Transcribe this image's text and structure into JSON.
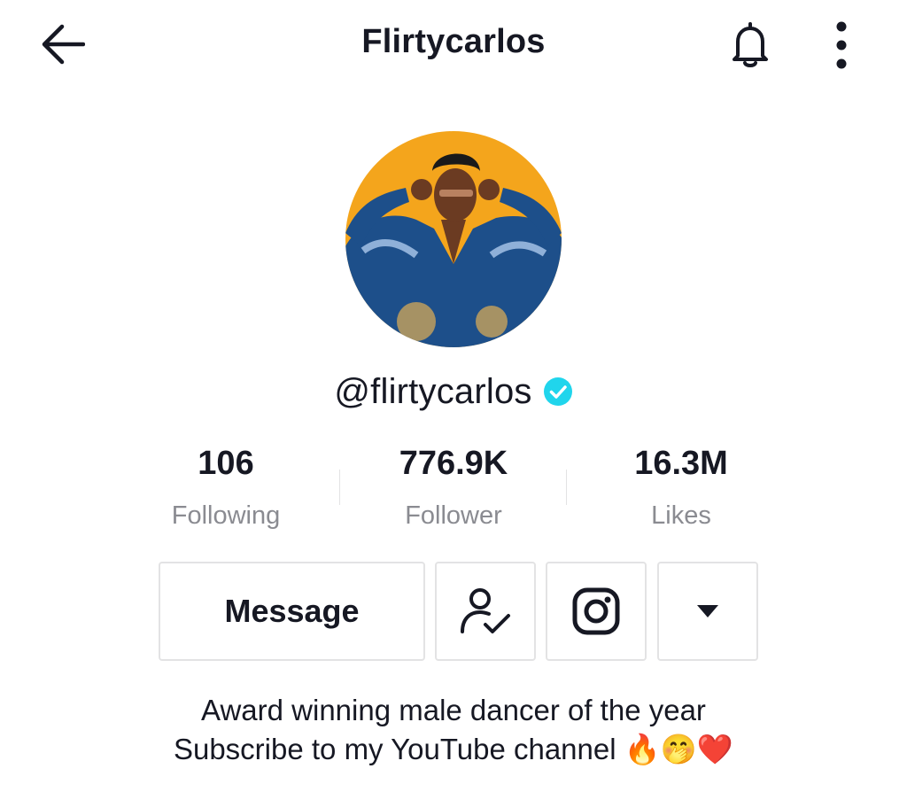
{
  "header": {
    "title": "Flirtycarlos",
    "back_icon": "arrow-left-icon",
    "bell_icon": "bell-icon",
    "more_icon": "vertical-dots-icon"
  },
  "profile": {
    "username": "@flirtycarlos",
    "verified_icon": "verified-check-icon",
    "avatar_icon": "profile-photo"
  },
  "stats": [
    {
      "value": "106",
      "label": "Following"
    },
    {
      "value": "776.9K",
      "label": "Follower"
    },
    {
      "value": "16.3M",
      "label": "Likes"
    }
  ],
  "actions": {
    "message_label": "Message",
    "friend_icon": "user-check-icon",
    "instagram_icon": "instagram-icon",
    "more_icon": "caret-down-icon"
  },
  "bio": {
    "line1": "Award winning male dancer of the year",
    "line2": "Subscribe to my YouTube channel 🔥🤭❤️"
  },
  "colors": {
    "text": "#161823",
    "secondary_text": "#8a8b91",
    "border": "#e3e3e4",
    "verified": "#20d5ec",
    "avatar_background": "#f4a51c",
    "shirt": "#1d4f8a"
  }
}
